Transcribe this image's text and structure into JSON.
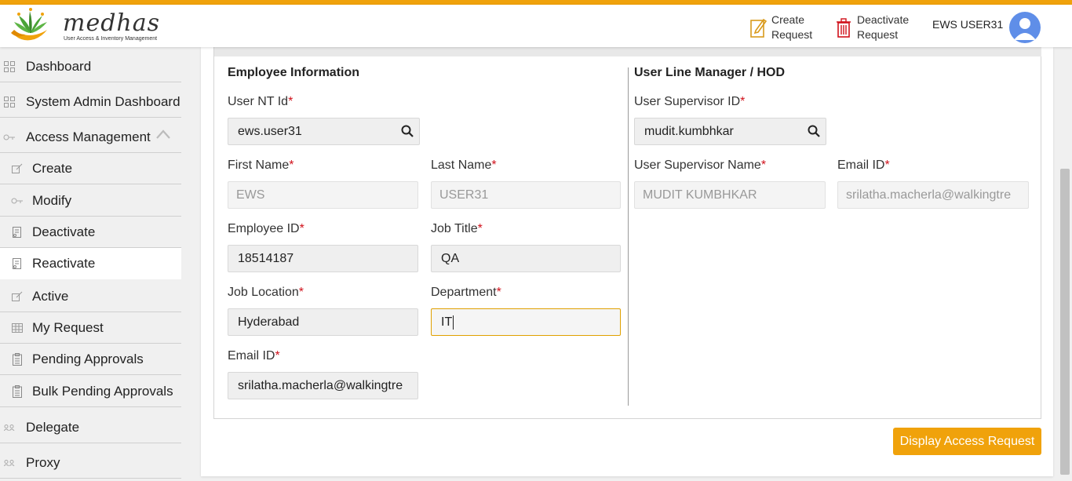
{
  "brand": {
    "name": "medhas",
    "tagline": "User Access & Inventory Management"
  },
  "header": {
    "create_request": [
      "Create",
      "Request"
    ],
    "deactivate_request": [
      "Deactivate",
      "Request"
    ],
    "user_name": "EWS USER31"
  },
  "sidebar": {
    "items": [
      {
        "label": "Dashboard",
        "icon": "grid-icon"
      },
      {
        "label": "System Admin Dashboard",
        "icon": "grid-icon"
      },
      {
        "label": "Access Management",
        "icon": "key-icon",
        "expanded": true
      },
      {
        "label": "Create",
        "icon": "edit-icon"
      },
      {
        "label": "Modify",
        "icon": "key-icon"
      },
      {
        "label": "Deactivate",
        "icon": "document-icon"
      },
      {
        "label": "Reactivate",
        "icon": "document-icon",
        "active": true
      },
      {
        "label": "Active",
        "icon": "edit-icon"
      },
      {
        "label": "My Request",
        "icon": "table-icon"
      },
      {
        "label": "Pending Approvals",
        "icon": "clipboard-icon"
      },
      {
        "label": "Bulk Pending Approvals",
        "icon": "clipboard-icon"
      },
      {
        "label": "Delegate",
        "icon": "people-icon"
      },
      {
        "label": "Proxy",
        "icon": "people-icon"
      }
    ]
  },
  "employee": {
    "title": "Employee Information",
    "nt_id": {
      "label": "User NT Id",
      "value": "ews.user31"
    },
    "first_name": {
      "label": "First Name",
      "value": "EWS"
    },
    "last_name": {
      "label": "Last Name",
      "value": "USER31"
    },
    "employee_id": {
      "label": "Employee ID",
      "value": "18514187"
    },
    "job_title": {
      "label": "Job Title",
      "value": "QA"
    },
    "job_location": {
      "label": "Job Location",
      "value": "Hyderabad"
    },
    "department": {
      "label": "Department",
      "value": "IT"
    },
    "email": {
      "label": "Email ID",
      "value": "srilatha.macherla@walkingtre"
    }
  },
  "manager": {
    "title": "User Line Manager / HOD",
    "supervisor_id": {
      "label": "User Supervisor ID",
      "value": "mudit.kumbhkar"
    },
    "supervisor_name": {
      "label": "User Supervisor Name",
      "value": "MUDIT KUMBHKAR"
    },
    "email": {
      "label": "Email ID",
      "value": "srilatha.macherla@walkingtre"
    }
  },
  "required_marker": "*",
  "actions": {
    "display_access_request": "Display Access Request"
  },
  "colors": {
    "accent": "#f0a20b",
    "required": "#d0111b",
    "avatar": "#5f8ee8"
  }
}
